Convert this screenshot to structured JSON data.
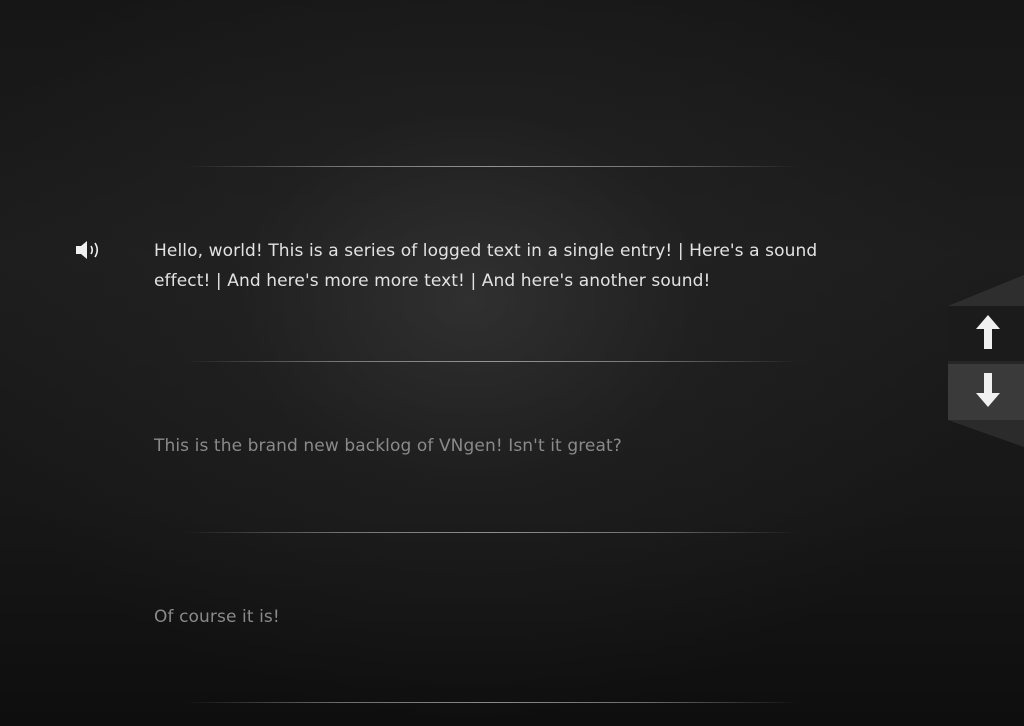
{
  "backlog": {
    "entries": [
      {
        "text": "Hello, world! This is a series of logged text in a single entry! | Here's a sound effect! | And here's more more text! | And here's another sound!",
        "has_voice": true,
        "state": "active"
      },
      {
        "text": "This is the brand new backlog of VNgen! Isn't it great?",
        "has_voice": false,
        "state": "faded"
      },
      {
        "text": "Of course it is!",
        "has_voice": false,
        "state": "faded"
      }
    ]
  },
  "icons": {
    "voice": "speaker-icon",
    "scroll_up": "arrow-up-icon",
    "scroll_down": "arrow-down-icon"
  },
  "colors": {
    "active_text": "#e2e2e2",
    "faded_text": "#8a8a8a",
    "icon": "#f0f0f0"
  }
}
